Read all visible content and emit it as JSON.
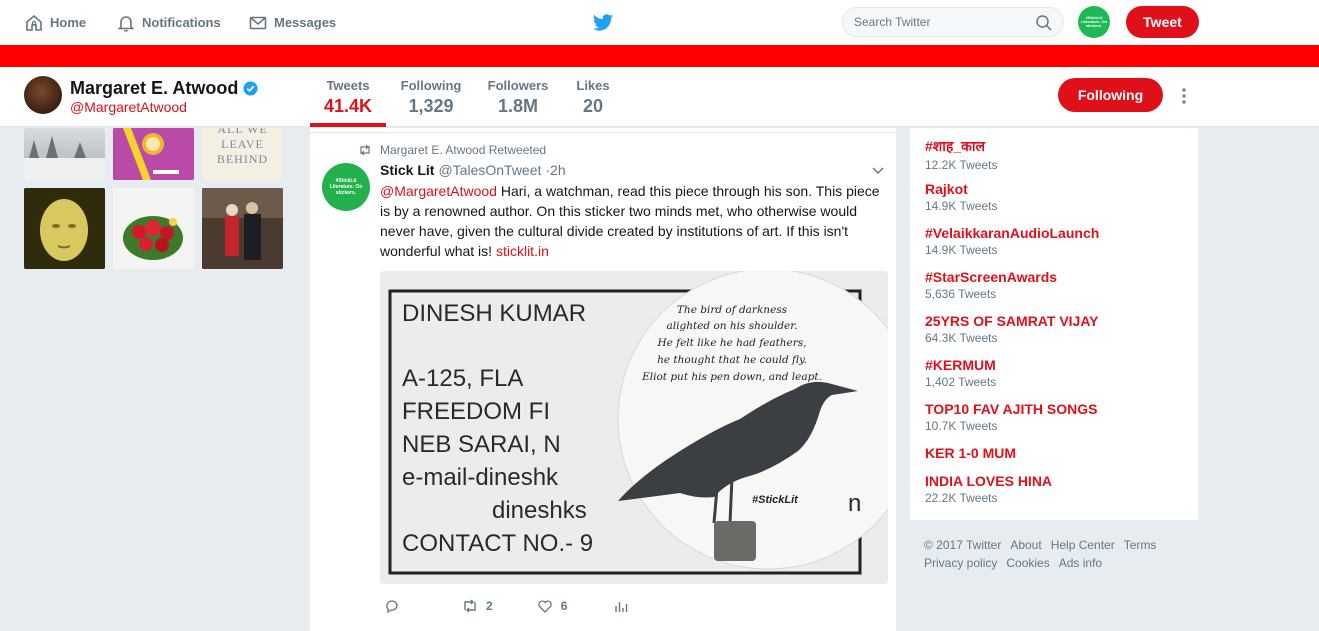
{
  "topnav": {
    "home_label": "Home",
    "notifications_label": "Notifications",
    "messages_label": "Messages",
    "search_placeholder": "Search Twitter",
    "tweet_button": "Tweet",
    "avatar_text": "#StickLit Literature. On stickers."
  },
  "colors": {
    "accent": "#e0101b",
    "band": "#ff0000",
    "twitter_blue": "#1da1f2",
    "background": "#e6ecf0"
  },
  "profile": {
    "name": "Margaret E. Atwood",
    "handle": "@MargaretAtwood",
    "stats": [
      {
        "label": "Tweets",
        "value": "41.4K"
      },
      {
        "label": "Following",
        "value": "1,329"
      },
      {
        "label": "Followers",
        "value": "1.8M"
      },
      {
        "label": "Likes",
        "value": "20"
      }
    ],
    "following_button": "Following"
  },
  "photos": {
    "book_lines": [
      "ALL WE",
      "LEAVE",
      "BEHIND"
    ]
  },
  "tweet": {
    "retweet_context": "Margaret E. Atwood Retweeted",
    "avatar_text": "#StickLit Literature. On stickers.",
    "author_name": "Stick Lit",
    "author_handle": "@TalesOnTweet",
    "time": "·2h",
    "mention": "@MargaretAtwood",
    "body": " Hari, a watchman, read this piece through his son. This piece is by a renowned author. On this sticker two minds met, who otherwise would never have, given the cultural divide created by institutions of art. If this isn't wonderful what is! ",
    "link": "sticklit.in",
    "media": {
      "card_lines": [
        "DINESH KUMAR",
        "A-125,      FLA",
        "FREEDOM FI",
        "NEB SARAI, N",
        "e-mail-dineshk",
        "dineshks",
        "CONTACT NO.- 9"
      ],
      "sticker_lines": [
        "The bird of darkness",
        "alighted on his shoulder.",
        "He felt like he had feathers,",
        "he thought that he could fly.",
        "Eliot put his pen down, and leapt."
      ],
      "sticker_tag": "#StickLit",
      "sticker_trail": "n"
    },
    "retweets": "2",
    "likes": "6"
  },
  "trends": [
    {
      "name": "#शाह_काल",
      "count": "12.2K Tweets"
    },
    {
      "name": "Rajkot",
      "count": "14.9K Tweets"
    },
    {
      "name": "#VelaikkaranAudioLaunch",
      "count": "14.9K Tweets"
    },
    {
      "name": "#StarScreenAwards",
      "count": "5,636 Tweets"
    },
    {
      "name": "25YRS OF SAMRAT VIJAY",
      "count": "64.3K Tweets"
    },
    {
      "name": "#KERMUM",
      "count": "1,402 Tweets"
    },
    {
      "name": "TOP10 FAV AJITH SONGS",
      "count": "10.7K Tweets"
    },
    {
      "name": "KER 1-0 MUM",
      "count": ""
    },
    {
      "name": "INDIA LOVES HINA",
      "count": "22.2K Tweets"
    }
  ],
  "footer": {
    "copyright": "© 2017 Twitter",
    "about": "About",
    "help": "Help Center",
    "terms": "Terms",
    "privacy": "Privacy policy",
    "cookies": "Cookies",
    "ads": "Ads info"
  }
}
